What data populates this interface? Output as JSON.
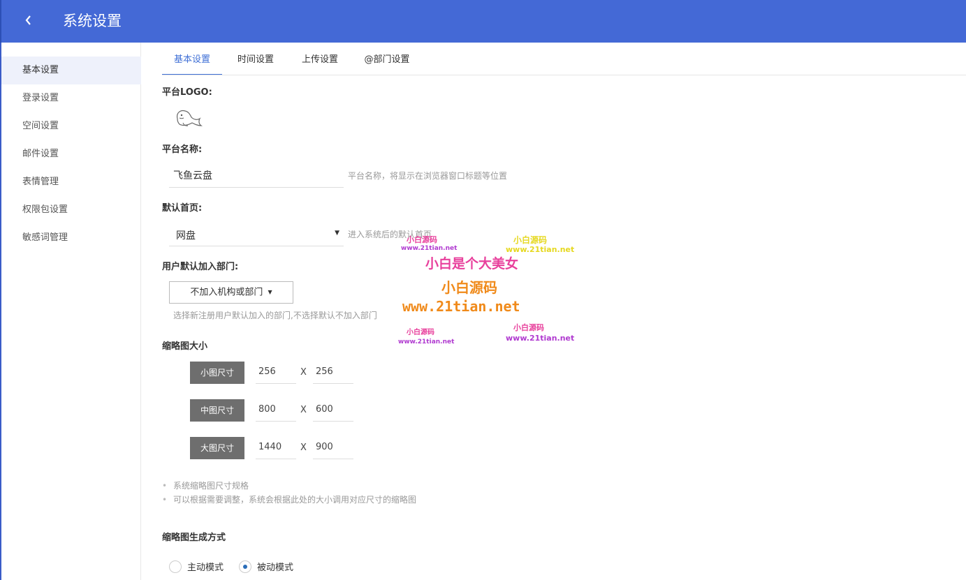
{
  "header": {
    "title": "系统设置"
  },
  "sidebar": {
    "items": [
      {
        "label": "基本设置",
        "active": true
      },
      {
        "label": "登录设置"
      },
      {
        "label": "空间设置"
      },
      {
        "label": "邮件设置"
      },
      {
        "label": "表情管理"
      },
      {
        "label": "权限包设置"
      },
      {
        "label": "敏感词管理"
      }
    ]
  },
  "tabs": [
    {
      "label": "基本设置",
      "active": true
    },
    {
      "label": "时间设置"
    },
    {
      "label": "上传设置"
    },
    {
      "label": "@部门设置"
    }
  ],
  "form": {
    "logo_label": "平台LOGO:",
    "name_label": "平台名称:",
    "name_value": "飞鱼云盘",
    "name_hint": "平台名称，将显示在浏览器窗口标题等位置",
    "home_label": "默认首页:",
    "home_value": "网盘",
    "home_hint": "进入系统后的默认首页",
    "dept_label": "用户默认加入部门:",
    "dept_button": "不加入机构或部门",
    "dept_hint": "选择新注册用户默认加入的部门,不选择默认不加入部门",
    "thumb_label": "缩略图大小",
    "sizes": [
      {
        "label": "小图尺寸",
        "width": "256",
        "height": "256"
      },
      {
        "label": "中图尺寸",
        "width": "800",
        "height": "600"
      },
      {
        "label": "大图尺寸",
        "width": "1440",
        "height": "900"
      }
    ],
    "x_sep": "X",
    "notes": [
      "系统缩略图尺寸规格",
      "可以根据需要调整，系统会根据此处的大小调用对应尺寸的缩略图"
    ],
    "gen_label": "缩略图生成方式",
    "modes": [
      {
        "label": "主动模式",
        "checked": false
      },
      {
        "label": "被动模式",
        "checked": true
      }
    ]
  },
  "watermark": {
    "small_cn": "小白源码",
    "small_url": "www.21tian.net",
    "big_slogan": "小白是个大美女",
    "big_cn": "小白源码",
    "big_url": "www.21tian.net",
    "pink": "#e8409c",
    "yellow": "#e6d820",
    "orange": "#f08a1a",
    "purple": "#b03ad0"
  }
}
